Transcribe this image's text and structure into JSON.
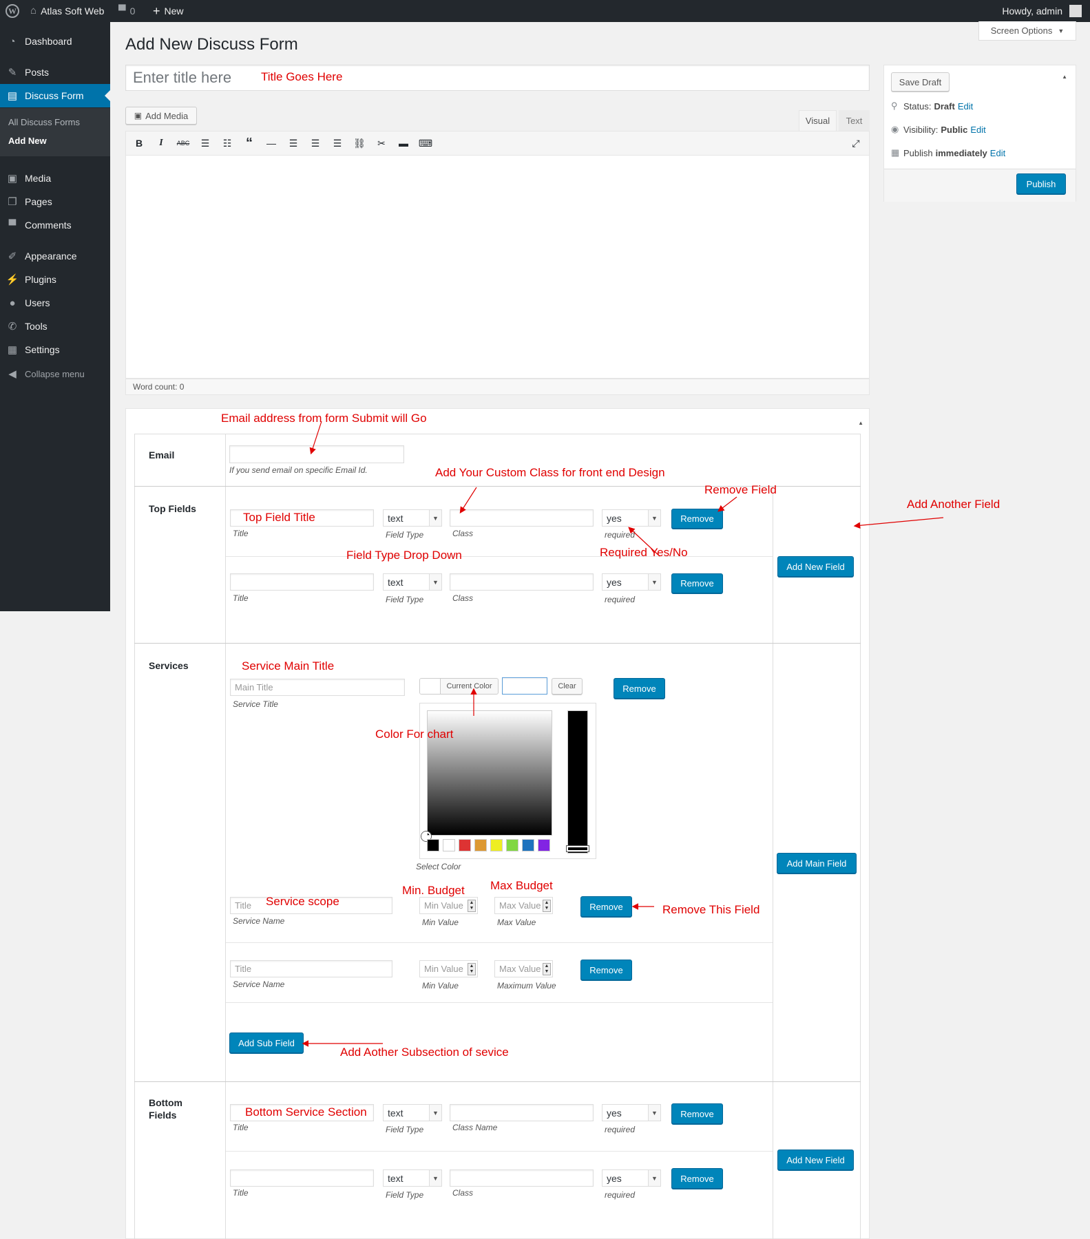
{
  "adminbar": {
    "site_name": "Atlas Soft Web",
    "comments_count": "0",
    "new_label": "New",
    "howdy": "Howdy, admin"
  },
  "sidebar": {
    "items": [
      {
        "label": "Dashboard"
      },
      {
        "label": "Posts"
      },
      {
        "label": "Discuss Form"
      },
      {
        "label": "Media"
      },
      {
        "label": "Pages"
      },
      {
        "label": "Comments"
      },
      {
        "label": "Appearance"
      },
      {
        "label": "Plugins"
      },
      {
        "label": "Users"
      },
      {
        "label": "Tools"
      },
      {
        "label": "Settings"
      }
    ],
    "submenu": [
      {
        "label": "All Discuss Forms"
      },
      {
        "label": "Add New"
      }
    ],
    "collapse": "Collapse menu"
  },
  "header": {
    "page_title": "Add New Discuss Form",
    "screen_options": "Screen Options"
  },
  "title_input": {
    "placeholder": "Enter title here"
  },
  "editor": {
    "add_media": "Add Media",
    "tab_visual": "Visual",
    "tab_text": "Text",
    "word_count": "Word count: 0"
  },
  "publish": {
    "save_draft": "Save Draft",
    "status_label": "Status:",
    "status_value": "Draft",
    "visibility_label": "Visibility:",
    "visibility_value": "Public",
    "publish_label": "Publish",
    "publish_value": "immediately",
    "edit": "Edit",
    "publish_button": "Publish"
  },
  "form": {
    "email": {
      "label": "Email",
      "desc": "If you send email on specific Email Id."
    },
    "top": {
      "label": "Top Fields",
      "rows": [
        {
          "type": "text",
          "required": "yes",
          "title_desc": "Title",
          "type_desc": "Field Type",
          "class_desc": "Class",
          "required_desc": "required",
          "remove": "Remove"
        },
        {
          "type": "text",
          "required": "yes",
          "title_desc": "Title",
          "type_desc": "Field Type",
          "class_desc": "Class",
          "required_desc": "required",
          "remove": "Remove"
        }
      ],
      "add": "Add New Field"
    },
    "services": {
      "label": "Services",
      "main_title_placeholder": "Main Title",
      "service_title_desc": "Service Title",
      "current_color": "Current Color",
      "clear": "Clear",
      "remove": "Remove",
      "select_color": "Select Color",
      "swatches": [
        "#000000",
        "#ffffff",
        "#dd3333",
        "#dd9933",
        "#eeee22",
        "#81d742",
        "#1e73be",
        "#8224e3"
      ],
      "sub_rows": [
        {
          "title_placeholder": "Title",
          "min_placeholder": "Min Value",
          "max_placeholder": "Max Value",
          "name_desc": "Service Name",
          "min_desc": "Min Value",
          "max_desc": "Max Value",
          "remove": "Remove"
        },
        {
          "title_placeholder": "Title",
          "min_placeholder": "Min Value",
          "max_placeholder": "Max Value",
          "name_desc": "Service Name",
          "min_desc": "Min Value",
          "max_desc": "Maximum Value",
          "remove": "Remove"
        }
      ],
      "add_sub": "Add Sub Field",
      "add_main": "Add Main Field"
    },
    "bottom": {
      "label_1": "Bottom",
      "label_2": "Fields",
      "rows": [
        {
          "type": "text",
          "required": "yes",
          "title_desc": "Title",
          "type_desc": "Field Type",
          "class_desc": "Class Name",
          "required_desc": "required",
          "remove": "Remove"
        },
        {
          "type": "text",
          "required": "yes",
          "title_desc": "Title",
          "type_desc": "Field Type",
          "class_desc": "Class",
          "required_desc": "required",
          "remove": "Remove"
        }
      ],
      "add": "Add New Field"
    }
  },
  "annotations": {
    "title": "Title Goes Here",
    "email": "Email address from form Submit will Go",
    "custom_class": "Add Your Custom Class for front end Design",
    "remove_field": "Remove Field",
    "add_another": "Add Another Field",
    "top_title": "Top Field Title",
    "field_type": "Field Type Drop Down",
    "required": "Required Yes/No",
    "service_main": "Service Main Title",
    "color_chart": "Color For chart",
    "min_budget": "Min. Budget",
    "max_budget": "Max Budget",
    "service_scope": "Service scope",
    "remove_this": "Remove This Field",
    "add_subsection": "Add Aother Subsection of sevice",
    "bottom_section": "Bottom Service Section"
  }
}
